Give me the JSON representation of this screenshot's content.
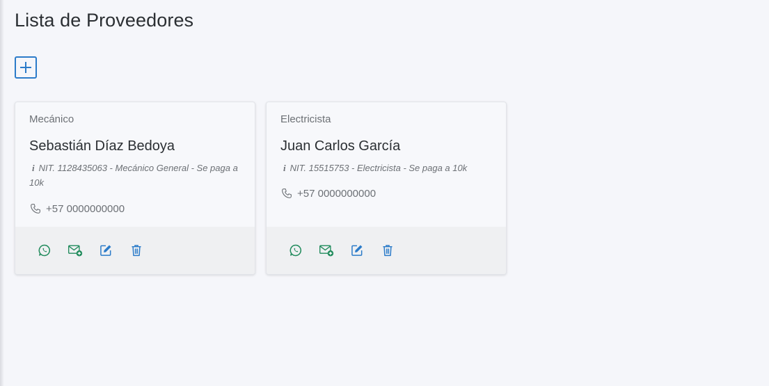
{
  "page": {
    "title": "Lista de Proveedores"
  },
  "add_button": {
    "icon": "plus-icon"
  },
  "colors": {
    "accent": "#2b7bc9",
    "whatsapp": "#1f8a5b",
    "mail": "#1f8a5b",
    "edit": "#2b7bc9",
    "delete": "#2b7bc9",
    "background": "#f5f6fa"
  },
  "providers": [
    {
      "category": "Mecánico",
      "name": "Sebastián Díaz Bedoya",
      "description": "NIT. 1128435063 - Mecánico General - Se paga a 10k",
      "phone": "+57 0000000000"
    },
    {
      "category": "Electricista",
      "name": "Juan Carlos García",
      "description": "NIT. 15515753 - Electricista - Se paga a 10k",
      "phone": "+57 0000000000"
    }
  ],
  "actions": {
    "icons": [
      "whatsapp-icon",
      "mail-add-icon",
      "edit-icon",
      "trash-icon"
    ]
  }
}
